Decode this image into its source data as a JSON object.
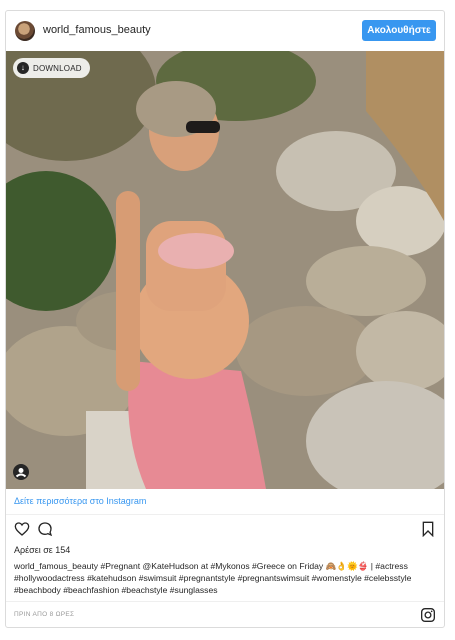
{
  "post": {
    "username": "world_famous_beauty",
    "follow_label": "Ακολουθήστε",
    "download_label": "DOWNLOAD",
    "more_link": "Δείτε περισσότερα στο Instagram",
    "likes": "Αρέσει σε 154",
    "caption": "world_famous_beauty #Pregnant @KateHudson at #Mykonos #Greece on Friday 🙈👌🌞👙 | #actress #hollywoodactress #katehudson #swimsuit #pregnantstyle #pregnantswimsuit #womenstyle #celebsstyle #beachbody #beachfashion #beachstyle #sunglasses",
    "timestamp": "ΠΡΙΝ ΑΠΟ 8 ΩΡΕΣ"
  },
  "colors": {
    "accent": "#3897f0",
    "text": "#262626",
    "muted": "#999999",
    "border": "#dbdbdb"
  },
  "icons": [
    "avatar",
    "download-icon",
    "user-tag-icon",
    "heart-icon",
    "comment-icon",
    "bookmark-icon",
    "instagram-icon"
  ]
}
